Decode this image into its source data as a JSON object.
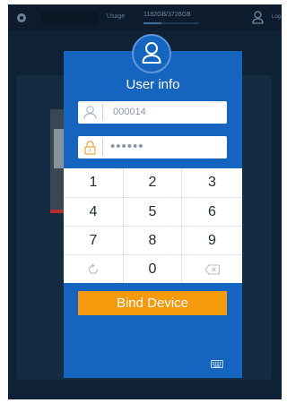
{
  "background_app": {
    "usage_label": "Usage",
    "usage_value": "1182GB/3726GB",
    "usage_fraction": 0.317,
    "login_label": "Log"
  },
  "dialog": {
    "title": "User info",
    "username_value": "000014",
    "password_value": "••••••",
    "keypad": [
      [
        "1",
        "2",
        "3"
      ],
      [
        "4",
        "5",
        "6"
      ],
      [
        "7",
        "8",
        "9"
      ],
      [
        "refresh-icon",
        "0",
        "backspace-icon"
      ]
    ],
    "bind_button_label": "Bind Device",
    "keyboard_icon": "keyboard-icon"
  },
  "colors": {
    "dialog_blue": "#1565c0",
    "button_orange": "#f59a0c",
    "backdrop": "#0f2235"
  }
}
